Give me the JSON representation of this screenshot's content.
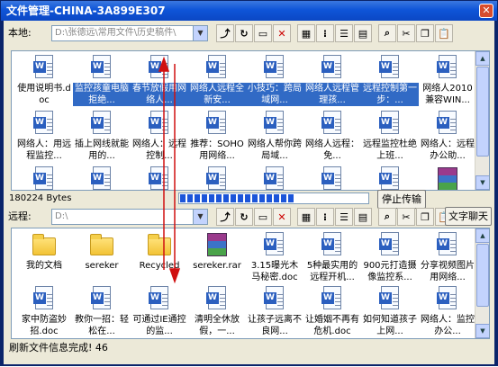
{
  "window": {
    "title": "文件管理-CHINA-3A899E307"
  },
  "local": {
    "label": "本地:",
    "path": "D:\\张德远\\常用文件\\历史稿件\\",
    "items": [
      {
        "name": "使用说明书.doc",
        "icon": "word-doc-icon",
        "selected": false
      },
      {
        "name": "监控孩童电脑拒绝...",
        "icon": "word-doc-icon",
        "selected": true
      },
      {
        "name": "春节放假用网络人...",
        "icon": "word-doc-icon",
        "selected": true
      },
      {
        "name": "网络人远程全新安...",
        "icon": "word-doc-icon",
        "selected": true
      },
      {
        "name": "小技巧：跨局域网...",
        "icon": "word-doc-icon",
        "selected": true
      },
      {
        "name": "网络人远程管理孩...",
        "icon": "word-doc-icon",
        "selected": true
      },
      {
        "name": "远程控制第一步：...",
        "icon": "word-doc-icon",
        "selected": true
      },
      {
        "name": "网络人2010兼容WIN...",
        "icon": "word-doc-icon",
        "selected": false
      },
      {
        "name": "网络人：用远程监控...",
        "icon": "word-doc-icon",
        "selected": false
      },
      {
        "name": "插上网线就能用的...",
        "icon": "word-doc-icon",
        "selected": false
      },
      {
        "name": "网络人：远程控制...",
        "icon": "word-doc-icon",
        "selected": false
      },
      {
        "name": "推荐：SOHO用网络...",
        "icon": "word-doc-icon",
        "selected": false
      },
      {
        "name": "网络人帮你跨局域...",
        "icon": "word-doc-icon",
        "selected": false
      },
      {
        "name": "网络人远程：免...",
        "icon": "word-doc-icon",
        "selected": false
      },
      {
        "name": "远程监控杜绝上班...",
        "icon": "word-doc-icon",
        "selected": false
      },
      {
        "name": "网络人：远程办公助...",
        "icon": "word-doc-icon",
        "selected": false
      },
      {
        "name": "",
        "icon": "word-doc-icon",
        "selected": false
      },
      {
        "name": "",
        "icon": "word-doc-icon",
        "selected": false
      },
      {
        "name": "",
        "icon": "word-doc-icon",
        "selected": false
      },
      {
        "name": "",
        "icon": "word-doc-icon",
        "selected": false
      },
      {
        "name": "",
        "icon": "word-doc-icon",
        "selected": false
      },
      {
        "name": "",
        "icon": "word-doc-icon",
        "selected": false
      },
      {
        "name": "",
        "icon": "word-doc-icon",
        "selected": false
      },
      {
        "name": "",
        "icon": "winrar-icon",
        "selected": false
      }
    ]
  },
  "transfer": {
    "bytes": "180224 Bytes",
    "progress_blocks": 16,
    "stop_button": "停止传输",
    "chat_button": "文字聊天"
  },
  "remote": {
    "label": "远程:",
    "path": "D:\\",
    "items": [
      {
        "name": "我的文档",
        "icon": "folder-icon"
      },
      {
        "name": "sereker",
        "icon": "folder-icon"
      },
      {
        "name": "Recycled",
        "icon": "folder-icon"
      },
      {
        "name": "sereker.rar",
        "icon": "winrar-icon"
      },
      {
        "name": "3.15曝光木马秘密.doc",
        "icon": "word-doc-icon"
      },
      {
        "name": "5种最实用的远程开机...",
        "icon": "word-doc-icon"
      },
      {
        "name": "900元打造摄像监控系...",
        "icon": "word-doc-icon"
      },
      {
        "name": "分享视频图片用网络...",
        "icon": "word-doc-icon"
      },
      {
        "name": "家中防盗妙招.doc",
        "icon": "word-doc-icon"
      },
      {
        "name": "教你一招：轻松在...",
        "icon": "word-doc-icon"
      },
      {
        "name": "可通过IE通控的监...",
        "icon": "word-doc-icon"
      },
      {
        "name": "清明全休放假，一...",
        "icon": "word-doc-icon"
      },
      {
        "name": "让孩子远离不良网...",
        "icon": "word-doc-icon"
      },
      {
        "name": "让婚姻不再有危机.doc",
        "icon": "word-doc-icon"
      },
      {
        "name": "如何知道孩子上网...",
        "icon": "word-doc-icon"
      },
      {
        "name": "网络人：监控办公...",
        "icon": "word-doc-icon"
      }
    ]
  },
  "status": {
    "text": "刷新文件信息完成! 46"
  },
  "toolbar": [
    {
      "name": "up-folder-icon",
      "glyph": "⤴"
    },
    {
      "name": "refresh-icon",
      "glyph": "↻"
    },
    {
      "name": "new-folder-icon",
      "glyph": "▭"
    },
    {
      "name": "delete-icon",
      "glyph": "✕"
    },
    {
      "name": "large-icons-view-icon",
      "glyph": "▦"
    },
    {
      "name": "small-icons-view-icon",
      "glyph": "⁝"
    },
    {
      "name": "list-view-icon",
      "glyph": "☰"
    },
    {
      "name": "details-view-icon",
      "glyph": "▤"
    },
    {
      "name": "search-icon",
      "glyph": "⌕"
    },
    {
      "name": "cut-icon",
      "glyph": "✂"
    },
    {
      "name": "copy-icon",
      "glyph": "❐"
    },
    {
      "name": "paste-icon",
      "glyph": "📋"
    }
  ],
  "colors": {
    "selection": "#316ac5",
    "titlebar": "#0f55d8",
    "arrow": "#d01010"
  }
}
